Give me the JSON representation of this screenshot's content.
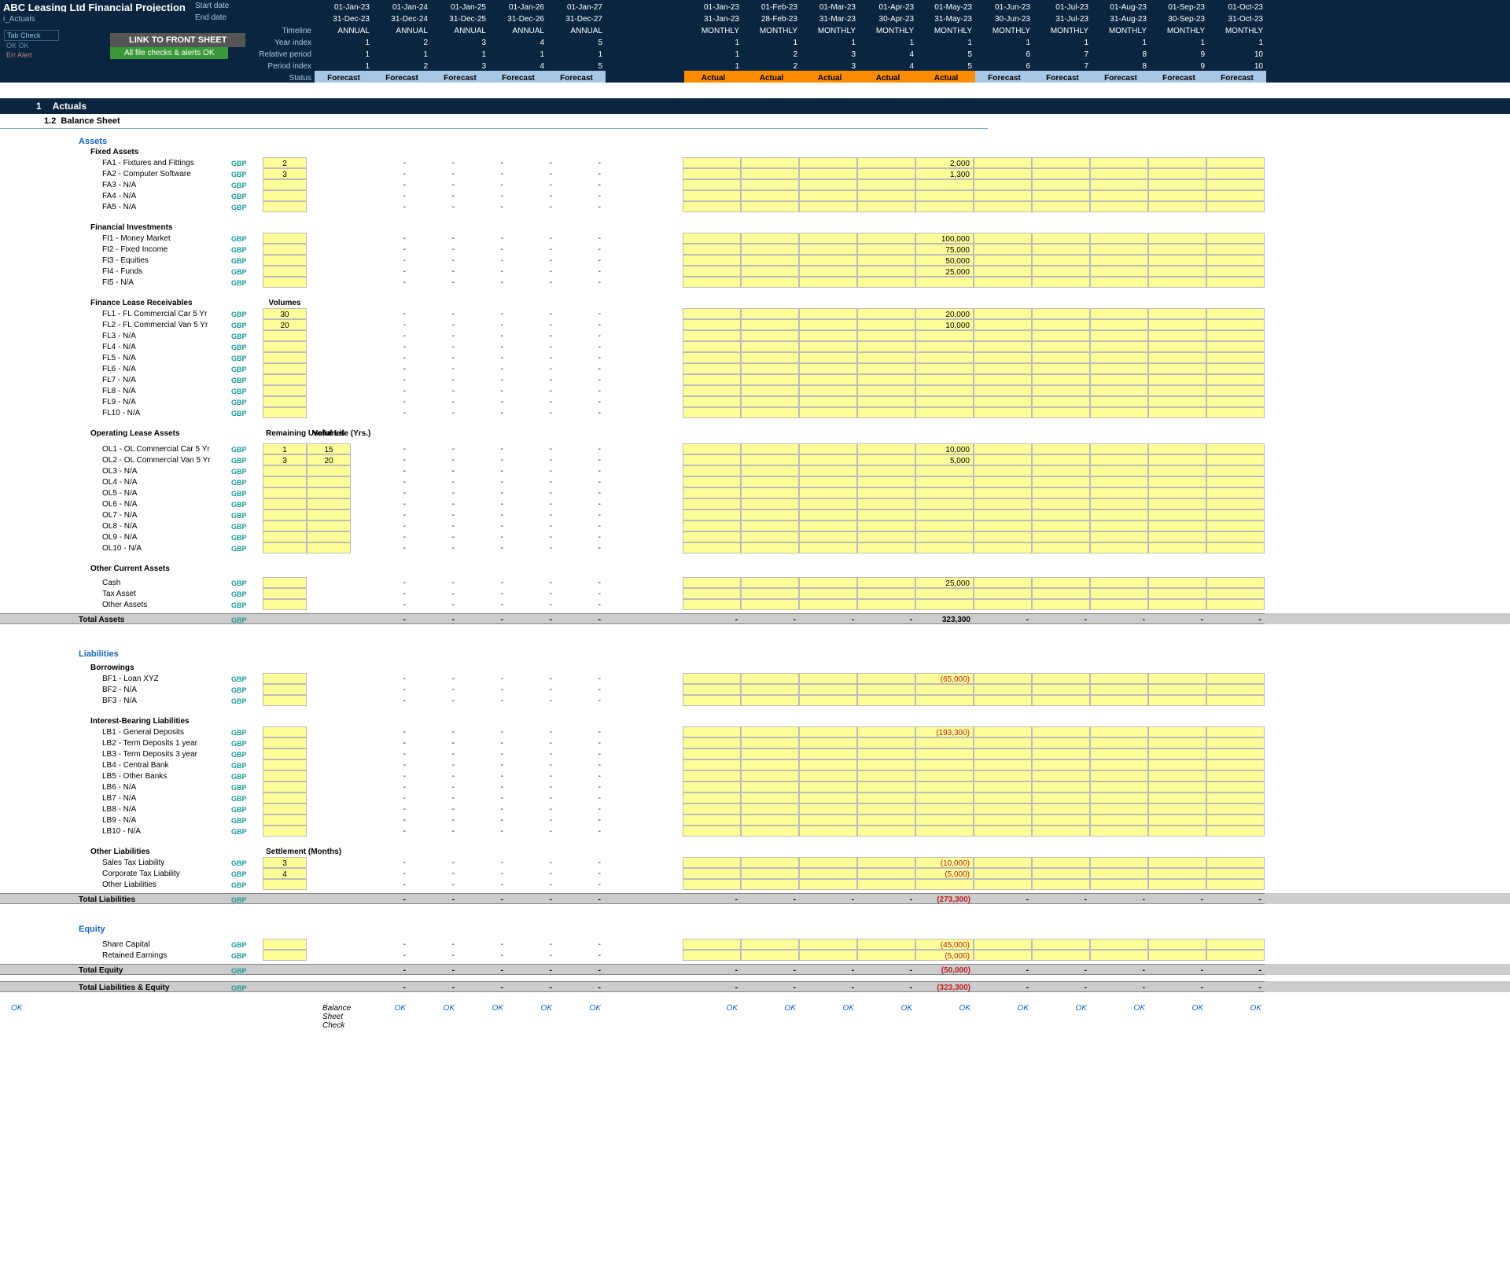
{
  "header": {
    "title": "ABC Leasing Ltd Financial Projection",
    "subtitle": "i_Actuals",
    "tab_check": {
      "title": "Tab Check",
      "ok": "OK  OK",
      "err": "Err  Alert"
    },
    "link_front": "LINK TO FRONT SHEET",
    "file_checks": "All file checks & alerts OK",
    "rows": [
      {
        "label": "Start date",
        "annual": [
          "01-Jan-23",
          "01-Jan-24",
          "01-Jan-25",
          "01-Jan-26",
          "01-Jan-27"
        ],
        "monthly": [
          "01-Jan-23",
          "01-Feb-23",
          "01-Mar-23",
          "01-Apr-23",
          "01-May-23",
          "01-Jun-23",
          "01-Jul-23",
          "01-Aug-23",
          "01-Sep-23",
          "01-Oct-23"
        ]
      },
      {
        "label": "End date",
        "annual": [
          "31-Dec-23",
          "31-Dec-24",
          "31-Dec-25",
          "31-Dec-26",
          "31-Dec-27"
        ],
        "monthly": [
          "31-Jan-23",
          "28-Feb-23",
          "31-Mar-23",
          "30-Apr-23",
          "31-May-23",
          "30-Jun-23",
          "31-Jul-23",
          "31-Aug-23",
          "30-Sep-23",
          "31-Oct-23"
        ]
      },
      {
        "label": "Timeline",
        "annual": [
          "ANNUAL",
          "ANNUAL",
          "ANNUAL",
          "ANNUAL",
          "ANNUAL"
        ],
        "monthly": [
          "MONTHLY",
          "MONTHLY",
          "MONTHLY",
          "MONTHLY",
          "MONTHLY",
          "MONTHLY",
          "MONTHLY",
          "MONTHLY",
          "MONTHLY",
          "MONTHLY"
        ]
      },
      {
        "label": "Year index",
        "annual": [
          "1",
          "2",
          "3",
          "4",
          "5"
        ],
        "monthly": [
          "1",
          "1",
          "1",
          "1",
          "1",
          "1",
          "1",
          "1",
          "1",
          "1"
        ]
      },
      {
        "label": "Relative period",
        "annual": [
          "1",
          "1",
          "1",
          "1",
          "1"
        ],
        "monthly": [
          "1",
          "2",
          "3",
          "4",
          "5",
          "6",
          "7",
          "8",
          "9",
          "10"
        ]
      },
      {
        "label": "Period index",
        "annual": [
          "1",
          "2",
          "3",
          "4",
          "5"
        ],
        "monthly": [
          "1",
          "2",
          "3",
          "4",
          "5",
          "6",
          "7",
          "8",
          "9",
          "10"
        ]
      }
    ],
    "status": {
      "label": "Status",
      "annual": [
        "Forecast",
        "Forecast",
        "Forecast",
        "Forecast",
        "Forecast"
      ],
      "monthly": [
        "Actual",
        "Actual",
        "Actual",
        "Actual",
        "Actual",
        "Forecast",
        "Forecast",
        "Forecast",
        "Forecast",
        "Forecast"
      ]
    }
  },
  "section": {
    "num": "1",
    "title": "Actuals"
  },
  "subsection": {
    "num": "1.2",
    "title": "Balance Sheet"
  },
  "currency": "GBP",
  "cat": {
    "assets": {
      "title": "Assets"
    },
    "fixed": {
      "title": "Fixed Assets",
      "rows": [
        {
          "name": "FA1 - Fixtures and Fittings",
          "i1": "2",
          "may": "2,000"
        },
        {
          "name": "FA2 - Computer Software",
          "i1": "3",
          "may": "1,300"
        },
        {
          "name": "FA3 - N/A"
        },
        {
          "name": "FA4 - N/A"
        },
        {
          "name": "FA5 - N/A"
        }
      ]
    },
    "fininv": {
      "title": "Financial Investments",
      "rows": [
        {
          "name": "FI1 - Money Market",
          "may": "100,000"
        },
        {
          "name": "FI2 - Fixed Income",
          "may": "75,000"
        },
        {
          "name": "FI3 - Equities",
          "may": "50,000"
        },
        {
          "name": "FI4 - Funds",
          "may": "25,000"
        },
        {
          "name": "FI5 - N/A"
        }
      ]
    },
    "flr": {
      "title": "Finance Lease Receivables",
      "col": "Volumes",
      "rows": [
        {
          "name": "FL1 - FL Commercial Car 5 Yr",
          "i1": "30",
          "may": "20,000"
        },
        {
          "name": "FL2 - FL Commercial Van 5 Yr",
          "i1": "20",
          "may": "10,000"
        },
        {
          "name": "FL3 - N/A"
        },
        {
          "name": "FL4 - N/A"
        },
        {
          "name": "FL5 - N/A"
        },
        {
          "name": "FL6 - N/A"
        },
        {
          "name": "FL7 - N/A"
        },
        {
          "name": "FL8 - N/A"
        },
        {
          "name": "FL9 - N/A"
        },
        {
          "name": "FL10 - N/A"
        }
      ]
    },
    "ola": {
      "title": "Operating Lease Assets",
      "col1": "Remaining Useful Life (Yrs.)",
      "col2": "Volumes",
      "rows": [
        {
          "name": "OL1 - OL Commercial Car 5 Yr",
          "i1": "1",
          "i2": "15",
          "may": "10,000"
        },
        {
          "name": "OL2 - OL Commercial Van 5 Yr",
          "i1": "3",
          "i2": "20",
          "may": "5,000"
        },
        {
          "name": "OL3 - N/A"
        },
        {
          "name": "OL4 - N/A"
        },
        {
          "name": "OL5 - N/A"
        },
        {
          "name": "OL6 - N/A"
        },
        {
          "name": "OL7 - N/A"
        },
        {
          "name": "OL8 - N/A"
        },
        {
          "name": "OL9 - N/A"
        },
        {
          "name": "OL10 - N/A"
        }
      ]
    },
    "oca": {
      "title": "Other Current Assets",
      "rows": [
        {
          "name": "Cash",
          "may": "25,000"
        },
        {
          "name": "Tax Asset"
        },
        {
          "name": "Other Assets"
        }
      ]
    },
    "total_assets": {
      "title": "Total Assets",
      "may": "323,300"
    },
    "liab": {
      "title": "Liabilities"
    },
    "bor": {
      "title": "Borrowings",
      "rows": [
        {
          "name": "BF1 - Loan XYZ",
          "may": "(65,000)"
        },
        {
          "name": "BF2 - N/A"
        },
        {
          "name": "BF3 - N/A"
        }
      ]
    },
    "ibl": {
      "title": "Interest-Bearing Liabilities",
      "rows": [
        {
          "name": "LB1 - General Deposits",
          "may": "(193,300)"
        },
        {
          "name": "LB2 - Term Deposits 1 year"
        },
        {
          "name": "LB3 - Term Deposits 3 year"
        },
        {
          "name": "LB4 - Central Bank"
        },
        {
          "name": "LB5 - Other Banks"
        },
        {
          "name": "LB6 - N/A"
        },
        {
          "name": "LB7 - N/A"
        },
        {
          "name": "LB8 - N/A"
        },
        {
          "name": "LB9 - N/A"
        },
        {
          "name": "LB10 - N/A"
        }
      ]
    },
    "ol": {
      "title": "Other Liabilities",
      "col": "Settlement (Months)",
      "rows": [
        {
          "name": "Sales Tax Liability",
          "i1": "3",
          "may": "(10,000)"
        },
        {
          "name": "Corporate Tax Liability",
          "i1": "4",
          "may": "(5,000)"
        },
        {
          "name": "Other Liabilities"
        }
      ]
    },
    "total_liab": {
      "title": "Total Liabilities",
      "may": "(273,300)"
    },
    "equity": {
      "title": "Equity",
      "rows": [
        {
          "name": "Share Capital",
          "may": "(45,000)"
        },
        {
          "name": "Retained Earnings",
          "may": "(5,000)"
        }
      ]
    },
    "total_eq": {
      "title": "Total Equity",
      "may": "(50,000)"
    },
    "total_le": {
      "title": "Total Liabilities & Equity",
      "may": "(323,300)"
    }
  },
  "footer": {
    "label": "Balance Sheet Check",
    "ok": "OK"
  }
}
